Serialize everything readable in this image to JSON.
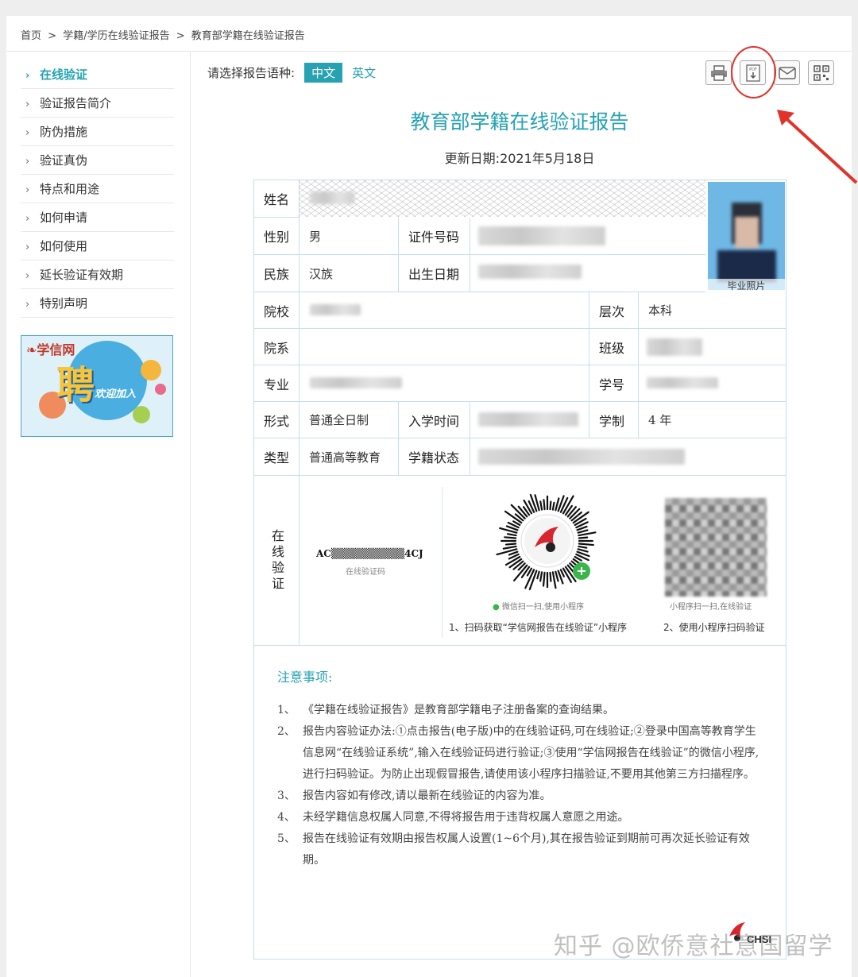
{
  "breadcrumb": [
    "首页",
    ">",
    "学籍/学历在线验证报告",
    ">",
    "教育部学籍在线验证报告"
  ],
  "sidebar": {
    "items": [
      {
        "label": "在线验证",
        "active": true
      },
      {
        "label": "验证报告简介",
        "active": false
      },
      {
        "label": "防伪措施",
        "active": false
      },
      {
        "label": "验证真伪",
        "active": false
      },
      {
        "label": "特点和用途",
        "active": false
      },
      {
        "label": "如何申请",
        "active": false
      },
      {
        "label": "如何使用",
        "active": false
      },
      {
        "label": "延长验证有效期",
        "active": false
      },
      {
        "label": "特别声明",
        "active": false
      }
    ],
    "ad": {
      "brand": "学信网",
      "big": "聘",
      "tag": "欢迎加入"
    }
  },
  "lang": {
    "prompt": "请选择报告语种:",
    "zh": "中文",
    "en": "英文"
  },
  "tools": [
    {
      "icon": "printer-icon"
    },
    {
      "icon": "pdf-download-icon"
    },
    {
      "icon": "mail-icon"
    },
    {
      "icon": "qr-code-icon"
    }
  ],
  "report": {
    "title": "教育部学籍在线验证报告",
    "date": "更新日期:2021年5月18日",
    "labels": {
      "name": "姓名",
      "gender": "性别",
      "id": "证件号码",
      "ethnicity": "民族",
      "birth": "出生日期",
      "school": "院校",
      "level": "层次",
      "dept": "院系",
      "class": "班级",
      "major": "专业",
      "student_no": "学号",
      "form": "形式",
      "enroll": "入学时间",
      "duration": "学制",
      "type": "类型",
      "status": "学籍状态",
      "verify": "在线验证"
    },
    "values": {
      "gender": "男",
      "ethnicity": "汉族",
      "level": "本科",
      "form": "普通全日制",
      "duration": "4 年",
      "type": "普通高等教育"
    },
    "photo_caption": "毕业照片",
    "verify_code": "AC▒▒▒▒▒▒▒▒▒▒4CJ",
    "verify_code_caption": "在线验证码",
    "qr1_caption": "微信扫一扫,使用小程序",
    "qr2_caption": "小程序扫一扫,在线验证",
    "step1": "1、扫码获取“学信网报告在线验证”小程序",
    "step2": "2、使用小程序扫码验证",
    "notes_title": "注意事项:",
    "notes": [
      {
        "n": "1、",
        "text": "《学籍在线验证报告》是教育部学籍电子注册备案的查询结果。"
      },
      {
        "n": "2、",
        "text": "报告内容验证办法:①点击报告(电子版)中的在线验证码,可在线验证;②登录中国高等教育学生信息网“在线验证系统”,输入在线验证码进行验证;③使用“学信网报告在线验证”的微信小程序,进行扫码验证。为防止出现假冒报告,请使用该小程序扫描验证,不要用其他第三方扫描程序。"
      },
      {
        "n": "3、",
        "text": "报告内容如有修改,请以最新在线验证的内容为准。"
      },
      {
        "n": "4、",
        "text": "未经学籍信息权属人同意,不得将报告用于违背权属人意愿之用途。"
      },
      {
        "n": "5、",
        "text": "报告在线验证有效期由报告权属人设置(1~6个月),其在报告验证到期前可再次延长验证有效期。"
      }
    ],
    "chsi_logo": "CHSI"
  },
  "watermark": "知乎 @欧侨意社意国留学",
  "colors": {
    "accent": "#26a2b3",
    "annotation": "#e0332b",
    "border": "#c6dfe8"
  }
}
